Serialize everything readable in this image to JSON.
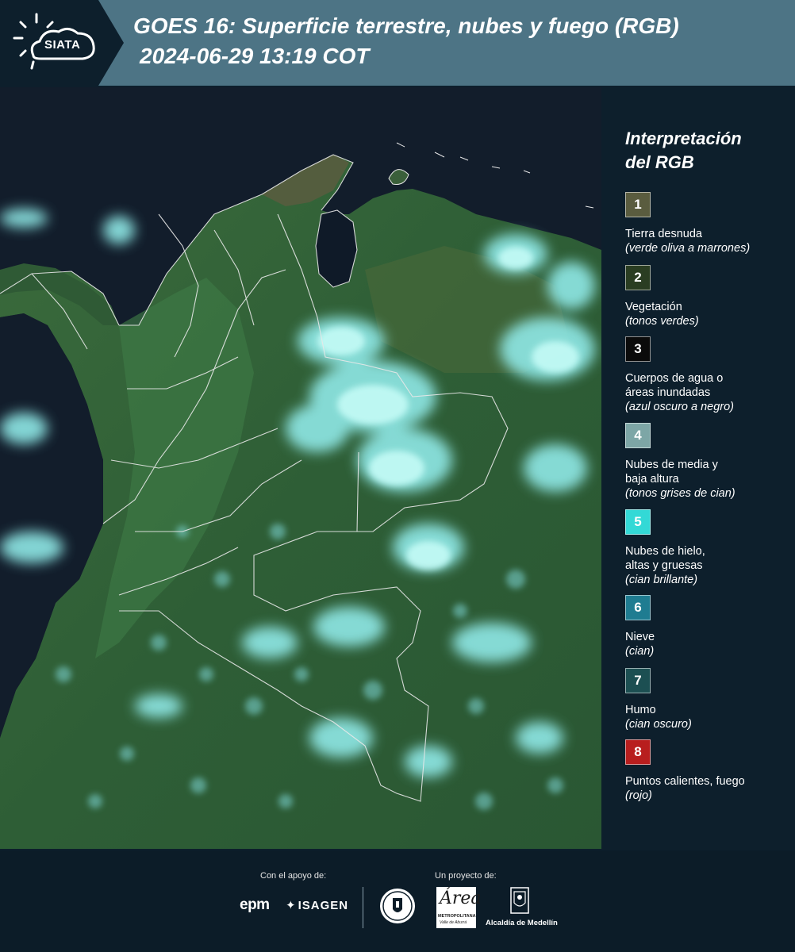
{
  "header": {
    "logo_text": "SIATA",
    "title_line1": "GOES 16: Superficie terrestre, nubes y fuego (RGB)",
    "title_line2": "2024-06-29 13:19 COT",
    "background": "#4d7485",
    "logo_background": "#0d1f2c"
  },
  "map": {
    "description_icon": "satellite-rgb-map",
    "colors": {
      "ocean": "#111c29",
      "vegetation": "#2f5d35",
      "vegetation_light": "#3f7a46",
      "cloud": "#8fe8e6",
      "cloud_bright": "#b9f6f2",
      "border": "#e8e8e8"
    }
  },
  "legend": {
    "title_line1": "Interpretación",
    "title_line2": "del RGB",
    "items": [
      {
        "number": "1",
        "color": "#5a5c3f",
        "label": "Tierra desnuda",
        "sub": "(verde oliva a marrones)"
      },
      {
        "number": "2",
        "color": "#2a3d22",
        "label": "Vegetación",
        "sub": "(tonos verdes)"
      },
      {
        "number": "3",
        "color": "#0b0b0b",
        "label_line1": "Cuerpos de agua o",
        "label_line2": "áreas inundadas",
        "sub": "(azul oscuro a negro)"
      },
      {
        "number": "4",
        "color": "#7da6a6",
        "label_line1": "Nubes de media y",
        "label_line2": "baja altura",
        "sub": "(tonos grises de cian)"
      },
      {
        "number": "5",
        "color": "#33d9d6",
        "label_line1": "Nubes de hielo,",
        "label_line2": "altas y gruesas",
        "sub": "(cian brillante)"
      },
      {
        "number": "6",
        "color": "#1f7c91",
        "label": "Nieve",
        "sub": "(cian)"
      },
      {
        "number": "7",
        "color": "#1c4f52",
        "label": "Humo",
        "sub": "(cian oscuro)"
      },
      {
        "number": "8",
        "color": "#b81e1e",
        "label": "Puntos calientes, fuego",
        "sub": "(rojo)"
      }
    ]
  },
  "footer": {
    "support_label": "Con el apoyo de:",
    "project_label": "Un proyecto de:",
    "epm": "epm",
    "isagen": "ISAGEN",
    "area_logo_main": "Área",
    "area_logo_line1": "METROPOLITANA",
    "area_logo_line2": "Valle de Aburrá",
    "medellin": "Alcaldía de Medellín"
  }
}
